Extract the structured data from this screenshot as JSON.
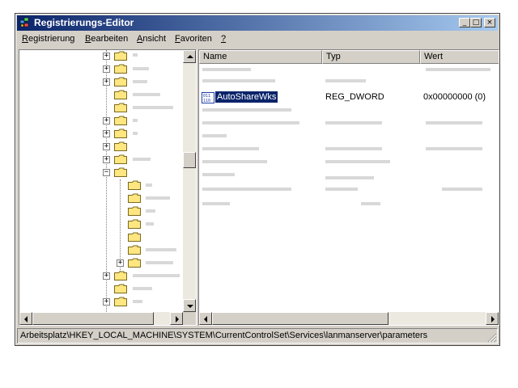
{
  "window": {
    "title": "Registrierungs-Editor"
  },
  "title_buttons": {
    "minimize": "_",
    "maximize": "□",
    "close": "×"
  },
  "menu": [
    {
      "hot": "R",
      "rest": "egistrierung"
    },
    {
      "hot": "B",
      "rest": "earbeiten"
    },
    {
      "hot": "A",
      "rest": "nsicht"
    },
    {
      "hot": "F",
      "rest": "avoriten"
    },
    {
      "hot": "?",
      "rest": ""
    }
  ],
  "list": {
    "columns": {
      "name": "Name",
      "type": "Typ",
      "value": "Wert"
    },
    "selected_row": {
      "name": "AutoShareWks",
      "type": "REG_DWORD",
      "value": "0x00000000 (0)"
    }
  },
  "status": {
    "path": "Arbeitsplatz\\HKEY_LOCAL_MACHINE\\SYSTEM\\CurrentControlSet\\Services\\lanmanserver\\parameters"
  },
  "icons": {
    "app": "registry-editor-icon",
    "folder": "folder-icon",
    "value": "binary-value-icon"
  },
  "colors": {
    "title_start": "#0a246a",
    "title_end": "#a6caf0",
    "selection": "#0a246a",
    "folder_yellow": "#ffe680"
  }
}
